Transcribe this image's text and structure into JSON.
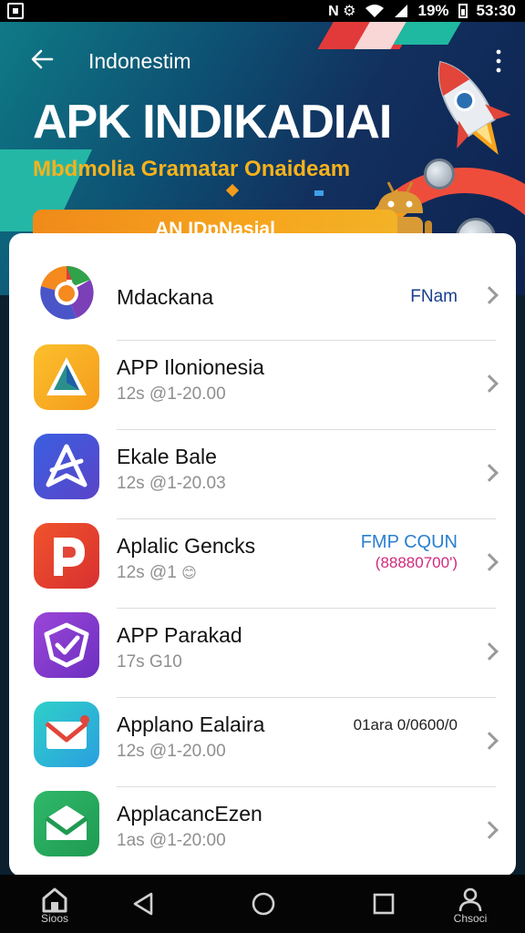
{
  "status_bar": {
    "left_glyphs": "N ⚙",
    "battery": "19%",
    "time": "53:30"
  },
  "header": {
    "title": "Indonestim",
    "back_icon": "arrow-left-icon",
    "menu_icon": "more-vert-icon"
  },
  "banner": {
    "headline": "APK INDIKADIAI",
    "subheadline": "Mbdmolia Gramatar Onaideam",
    "cta_label": "AN IDpNasial",
    "colors": {
      "accent_orange": "#f6a51d",
      "subtitle_gold": "#f6b21b",
      "bg_dark": "#12305e"
    }
  },
  "apps": [
    {
      "name": "Mdackana",
      "meta": "",
      "tag_line1": "FNam",
      "tag_line2": "",
      "tag_color": "#1a3f8f",
      "tag_color2": "",
      "icon": "chrome-like-icon"
    },
    {
      "name": "APP Ilonionesia",
      "meta": "12s @1-20.00",
      "tag_line1": "",
      "tag_line2": "",
      "tag_color": "",
      "tag_color2": "",
      "icon": "triangle-app-icon"
    },
    {
      "name": "Ekale Bale",
      "meta": "12s @1-20.03",
      "tag_line1": "",
      "tag_line2": "",
      "tag_color": "",
      "tag_color2": "",
      "icon": "arrow-app-icon"
    },
    {
      "name": "Aplalic Gencks",
      "meta": "12s @1",
      "meta_emoji": "😊",
      "tag_line1": "FMP CQUN",
      "tag_line2": "(88880700')",
      "tag_color": "#2a7fd0",
      "tag_color2": "#d02a7f",
      "icon": "p-letter-app-icon"
    },
    {
      "name": "APP Parakad",
      "meta": "17s G10",
      "tag_line1": "",
      "tag_line2": "",
      "tag_color": "",
      "tag_color2": "",
      "icon": "check-shield-app-icon"
    },
    {
      "name": "Applano Ealaira",
      "meta": "12s @1-20.00",
      "tag_line1": "01ara 0/0600/0",
      "tag_line2": "",
      "tag_color": "#222222",
      "tag_color2": "",
      "icon": "mail-app-icon"
    },
    {
      "name": "ApplacancEzen",
      "meta": "1as @1-20:00",
      "tag_line1": "",
      "tag_line2": "",
      "tag_color": "",
      "tag_color2": "",
      "icon": "envelope-green-app-icon"
    }
  ],
  "nav": {
    "home_label": "Sioos",
    "profile_label": "Chsoci",
    "icons": [
      "home-icon",
      "back-triangle-icon",
      "circle-home-icon",
      "square-recents-icon",
      "person-icon"
    ]
  }
}
